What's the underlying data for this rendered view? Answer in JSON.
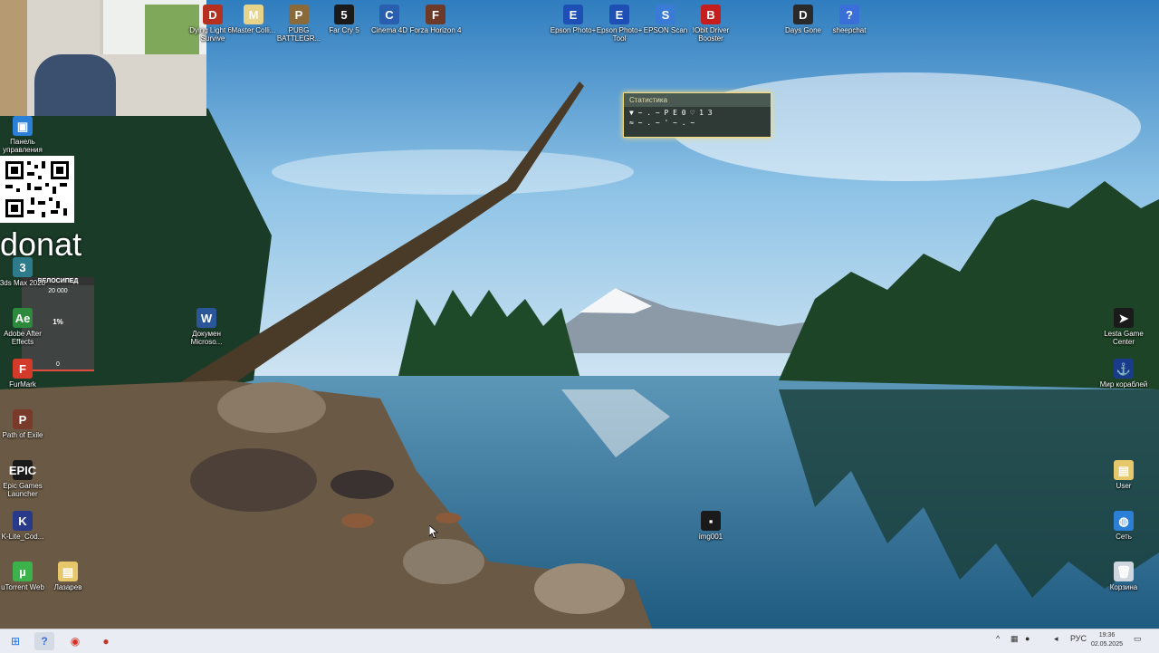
{
  "colors": {
    "sky_top": "#3b86c4",
    "sky_mid": "#8ec3e6",
    "water": "#3b7fa8",
    "taskbar": "#e9edf3",
    "stats_border": "#f2d97a",
    "goal_fill": "#e34b3c"
  },
  "desktop_icons_top": [
    {
      "label": "Dying Light 6 - Survive",
      "glyph": "D",
      "color": "#b5301f"
    },
    {
      "label": "Master Colli...",
      "glyph": "M",
      "color": "#e8d38a"
    },
    {
      "label": "PUBG BATTLEGR...",
      "glyph": "P",
      "color": "#8a6a3a"
    },
    {
      "label": "Far Cry 5",
      "glyph": "5",
      "color": "#1a1a1a"
    },
    {
      "label": "Cinema 4D",
      "glyph": "C",
      "color": "#2a5fb0"
    },
    {
      "label": "Forza Horizon 4",
      "glyph": "F",
      "color": "#6d3a2a"
    },
    {
      "label": "Epson Photo+",
      "glyph": "E",
      "color": "#1e4fb4"
    },
    {
      "label": "Epson Photo+ Tool",
      "glyph": "E",
      "color": "#1e4fb4"
    },
    {
      "label": "EPSON Scan",
      "glyph": "S",
      "color": "#3a7bd5"
    },
    {
      "label": "IObit Driver Booster",
      "glyph": "B",
      "color": "#c41e1e"
    },
    {
      "label": "Days Gone",
      "glyph": "D",
      "color": "#2a2a2a"
    },
    {
      "label": "sheepchat",
      "glyph": "?",
      "color": "#3a6fd9"
    }
  ],
  "desktop_icons_left": [
    {
      "label": "Панель управления",
      "glyph": "▣",
      "color": "#2b7fd6"
    },
    {
      "label": "3ds Max 2020",
      "glyph": "3",
      "color": "#2e7b8c"
    },
    {
      "label": "Adobe After Effects",
      "glyph": "Ae",
      "color": "#2d8a3c"
    },
    {
      "label": "FurMark",
      "glyph": "F",
      "color": "#d43a2a"
    },
    {
      "label": "Path of Exile",
      "glyph": "P",
      "color": "#7a3a2a"
    },
    {
      "label": "Epic Games Launcher",
      "glyph": "EPIC",
      "color": "#1a1a1a"
    },
    {
      "label": "K-Lite_Cod...",
      "glyph": "K",
      "color": "#2a3a8a"
    },
    {
      "label": "uTorrent Web",
      "glyph": "µ",
      "color": "#3bb24a"
    }
  ],
  "desktop_icons_misc": [
    {
      "label": "Лазарев",
      "glyph": "▤",
      "color": "#e6c86a"
    },
    {
      "label": "Докумен Microso...",
      "glyph": "W",
      "color": "#2b579a"
    },
    {
      "label": "img001",
      "glyph": "▪",
      "color": "#1a1a1a"
    }
  ],
  "desktop_icons_right": [
    {
      "label": "Lesta Game Center",
      "glyph": "➤",
      "color": "#1a1a1a"
    },
    {
      "label": "Мир кораблей",
      "glyph": "⚓",
      "color": "#1a3a8a"
    },
    {
      "label": "User",
      "glyph": "▤",
      "color": "#e6c86a"
    },
    {
      "label": "Сеть",
      "glyph": "◍",
      "color": "#2b7fd6"
    },
    {
      "label": "Корзина",
      "glyph": "🗑",
      "color": "#d0d6dd"
    }
  ],
  "overlay": {
    "donat_text": "donat",
    "goal_title": "ВЕЛОСИПЕД",
    "goal_target": "20 000",
    "goal_percent_text": "1%",
    "goal_percent": 0.01,
    "goal_current": "0"
  },
  "stats_widget": {
    "title": "Статистика",
    "line1": "▼ ~ . ~ P E 0 ♡ 1 3",
    "line2": "≈ ~ . ~ ' ~ . ~"
  },
  "taskbar": {
    "start_icon": "⊞",
    "apps": [
      {
        "name": "copilot-taskbar-icon",
        "glyph": "?"
      },
      {
        "name": "chrome-taskbar-icon",
        "glyph": "◉"
      },
      {
        "name": "obs-taskbar-icon",
        "glyph": "●"
      }
    ],
    "tray_chevron": "^",
    "language": "РУС",
    "time": "19:36",
    "date": "02.05.2025"
  }
}
